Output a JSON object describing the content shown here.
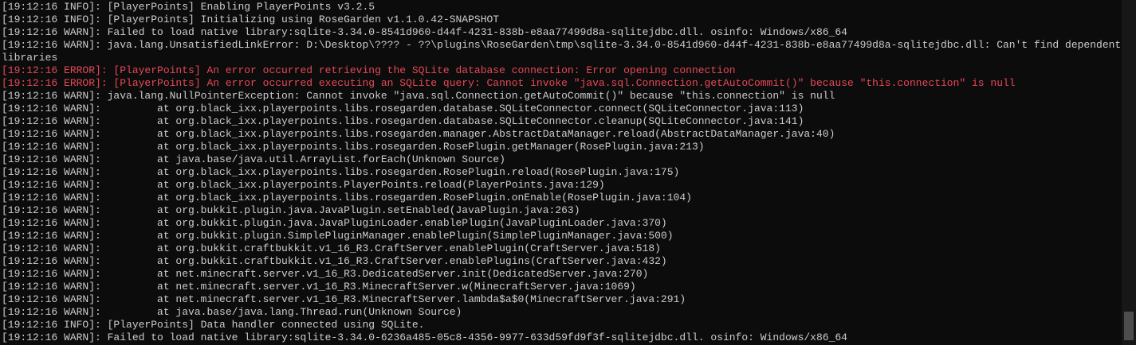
{
  "console": {
    "lines": [
      {
        "text": "[19:12:16 INFO]: [PlayerPoints] Enabling PlayerPoints v3.2.5",
        "level": "info"
      },
      {
        "text": "[19:12:16 INFO]: [PlayerPoints] Initializing using RoseGarden v1.1.0.42-SNAPSHOT",
        "level": "info"
      },
      {
        "text": "[19:12:16 WARN]: Failed to load native library:sqlite-3.34.0-8541d960-d44f-4231-838b-e8aa77499d8a-sqlitejdbc.dll. osinfo: Windows/x86_64",
        "level": "warn"
      },
      {
        "text": "[19:12:16 WARN]: java.lang.UnsatisfiedLinkError: D:\\Desktop\\???? - ??\\plugins\\RoseGarden\\tmp\\sqlite-3.34.0-8541d960-d44f-4231-838b-e8aa77499d8a-sqlitejdbc.dll: Can't find dependent libraries",
        "level": "warn",
        "wrap": true
      },
      {
        "text": "[19:12:16 ERROR]: [PlayerPoints] An error occurred retrieving the SQLite database connection: Error opening connection",
        "level": "error"
      },
      {
        "text": "[19:12:16 ERROR]: [PlayerPoints] An error occurred executing an SQLite query: Cannot invoke \"java.sql.Connection.getAutoCommit()\" because \"this.connection\" is null",
        "level": "error"
      },
      {
        "text": "[19:12:16 WARN]: java.lang.NullPointerException: Cannot invoke \"java.sql.Connection.getAutoCommit()\" because \"this.connection\" is null",
        "level": "warn"
      },
      {
        "text": "[19:12:16 WARN]:         at org.black_ixx.playerpoints.libs.rosegarden.database.SQLiteConnector.connect(SQLiteConnector.java:113)",
        "level": "warn"
      },
      {
        "text": "[19:12:16 WARN]:         at org.black_ixx.playerpoints.libs.rosegarden.database.SQLiteConnector.cleanup(SQLiteConnector.java:141)",
        "level": "warn"
      },
      {
        "text": "[19:12:16 WARN]:         at org.black_ixx.playerpoints.libs.rosegarden.manager.AbstractDataManager.reload(AbstractDataManager.java:40)",
        "level": "warn"
      },
      {
        "text": "[19:12:16 WARN]:         at org.black_ixx.playerpoints.libs.rosegarden.RosePlugin.getManager(RosePlugin.java:213)",
        "level": "warn"
      },
      {
        "text": "[19:12:16 WARN]:         at java.base/java.util.ArrayList.forEach(Unknown Source)",
        "level": "warn"
      },
      {
        "text": "[19:12:16 WARN]:         at org.black_ixx.playerpoints.libs.rosegarden.RosePlugin.reload(RosePlugin.java:175)",
        "level": "warn"
      },
      {
        "text": "[19:12:16 WARN]:         at org.black_ixx.playerpoints.PlayerPoints.reload(PlayerPoints.java:129)",
        "level": "warn"
      },
      {
        "text": "[19:12:16 WARN]:         at org.black_ixx.playerpoints.libs.rosegarden.RosePlugin.onEnable(RosePlugin.java:104)",
        "level": "warn"
      },
      {
        "text": "[19:12:16 WARN]:         at org.bukkit.plugin.java.JavaPlugin.setEnabled(JavaPlugin.java:263)",
        "level": "warn"
      },
      {
        "text": "[19:12:16 WARN]:         at org.bukkit.plugin.java.JavaPluginLoader.enablePlugin(JavaPluginLoader.java:370)",
        "level": "warn"
      },
      {
        "text": "[19:12:16 WARN]:         at org.bukkit.plugin.SimplePluginManager.enablePlugin(SimplePluginManager.java:500)",
        "level": "warn"
      },
      {
        "text": "[19:12:16 WARN]:         at org.bukkit.craftbukkit.v1_16_R3.CraftServer.enablePlugin(CraftServer.java:518)",
        "level": "warn"
      },
      {
        "text": "[19:12:16 WARN]:         at org.bukkit.craftbukkit.v1_16_R3.CraftServer.enablePlugins(CraftServer.java:432)",
        "level": "warn"
      },
      {
        "text": "[19:12:16 WARN]:         at net.minecraft.server.v1_16_R3.DedicatedServer.init(DedicatedServer.java:270)",
        "level": "warn"
      },
      {
        "text": "[19:12:16 WARN]:         at net.minecraft.server.v1_16_R3.MinecraftServer.w(MinecraftServer.java:1069)",
        "level": "warn"
      },
      {
        "text": "[19:12:16 WARN]:         at net.minecraft.server.v1_16_R3.MinecraftServer.lambda$a$0(MinecraftServer.java:291)",
        "level": "warn"
      },
      {
        "text": "[19:12:16 WARN]:         at java.base/java.lang.Thread.run(Unknown Source)",
        "level": "warn"
      },
      {
        "text": "[19:12:16 INFO]: [PlayerPoints] Data handler connected using SQLite.",
        "level": "info"
      },
      {
        "text": "[19:12:16 WARN]: Failed to load native library:sqlite-3.34.0-6236a485-05c8-4356-9977-633d59fd9f3f-sqlitejdbc.dll. osinfo: Windows/x86_64",
        "level": "warn"
      }
    ]
  },
  "colors": {
    "background": "#0c0c0c",
    "text": "#cccccc",
    "error": "#e74856",
    "scrollbar_track": "#171717",
    "scrollbar_thumb": "#4d4d4d"
  }
}
